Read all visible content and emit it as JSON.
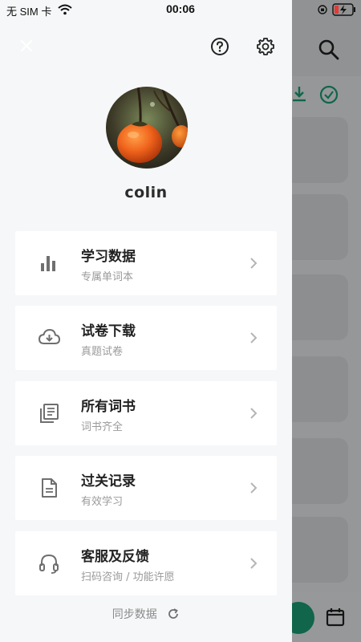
{
  "status_bar": {
    "carrier": "无 SIM 卡",
    "time": "00:06"
  },
  "drawer": {
    "username": "colin",
    "menu": [
      {
        "title": "学习数据",
        "subtitle": "专属单词本",
        "icon": "bar-chart-icon"
      },
      {
        "title": "试卷下载",
        "subtitle": "真题试卷",
        "icon": "cloud-download-icon"
      },
      {
        "title": "所有词书",
        "subtitle": "词书齐全",
        "icon": "library-books-icon"
      },
      {
        "title": "过关记录",
        "subtitle": "有效学习",
        "icon": "document-icon"
      },
      {
        "title": "客服及反馈",
        "subtitle": "扫码咨询 / 功能许愿",
        "icon": "headset-icon"
      }
    ],
    "sync_label": "同步数据"
  },
  "colors": {
    "drawer_bg": "#f5f7f8",
    "card_bg": "#ffffff",
    "accent_green": "#1aa37a",
    "icon_gray": "#6f6f6f"
  }
}
